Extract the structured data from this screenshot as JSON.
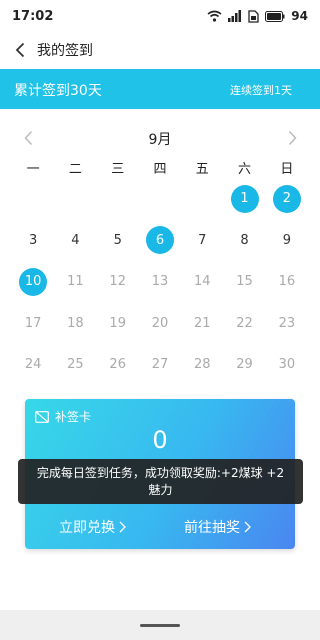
{
  "status_bar": {
    "time": "17:02",
    "battery": "94"
  },
  "nav": {
    "title": "我的签到"
  },
  "banner": {
    "total": "累计签到30天",
    "streak": "连续签到1天"
  },
  "calendar": {
    "month": "9月",
    "weekdays": [
      "一",
      "二",
      "三",
      "四",
      "五",
      "六",
      "日"
    ],
    "days": [
      {
        "label": "",
        "state": "empty"
      },
      {
        "label": "",
        "state": "empty"
      },
      {
        "label": "",
        "state": "empty"
      },
      {
        "label": "",
        "state": "empty"
      },
      {
        "label": "",
        "state": "empty"
      },
      {
        "label": "1",
        "state": "checked"
      },
      {
        "label": "2",
        "state": "checked"
      },
      {
        "label": "3",
        "state": "normal"
      },
      {
        "label": "4",
        "state": "normal"
      },
      {
        "label": "5",
        "state": "normal"
      },
      {
        "label": "6",
        "state": "checked"
      },
      {
        "label": "7",
        "state": "normal"
      },
      {
        "label": "8",
        "state": "normal"
      },
      {
        "label": "9",
        "state": "normal"
      },
      {
        "label": "10",
        "state": "checked"
      },
      {
        "label": "11",
        "state": "muted"
      },
      {
        "label": "12",
        "state": "muted"
      },
      {
        "label": "13",
        "state": "muted"
      },
      {
        "label": "14",
        "state": "muted"
      },
      {
        "label": "15",
        "state": "muted"
      },
      {
        "label": "16",
        "state": "muted"
      },
      {
        "label": "17",
        "state": "muted"
      },
      {
        "label": "18",
        "state": "muted"
      },
      {
        "label": "19",
        "state": "muted"
      },
      {
        "label": "20",
        "state": "muted"
      },
      {
        "label": "21",
        "state": "muted"
      },
      {
        "label": "22",
        "state": "muted"
      },
      {
        "label": "23",
        "state": "muted"
      },
      {
        "label": "24",
        "state": "muted"
      },
      {
        "label": "25",
        "state": "muted"
      },
      {
        "label": "26",
        "state": "muted"
      },
      {
        "label": "27",
        "state": "muted"
      },
      {
        "label": "28",
        "state": "muted"
      },
      {
        "label": "29",
        "state": "muted"
      },
      {
        "label": "30",
        "state": "muted"
      }
    ]
  },
  "card": {
    "title": "补签卡",
    "count": "0",
    "redeem_label": "立即兑换",
    "lottery_label": "前往抽奖"
  },
  "toast": {
    "message": "完成每日签到任务，成功领取奖励:+2煤球 +2魅力"
  },
  "colors": {
    "accent": "#21c2e7",
    "checked": "#1ab8e6"
  }
}
